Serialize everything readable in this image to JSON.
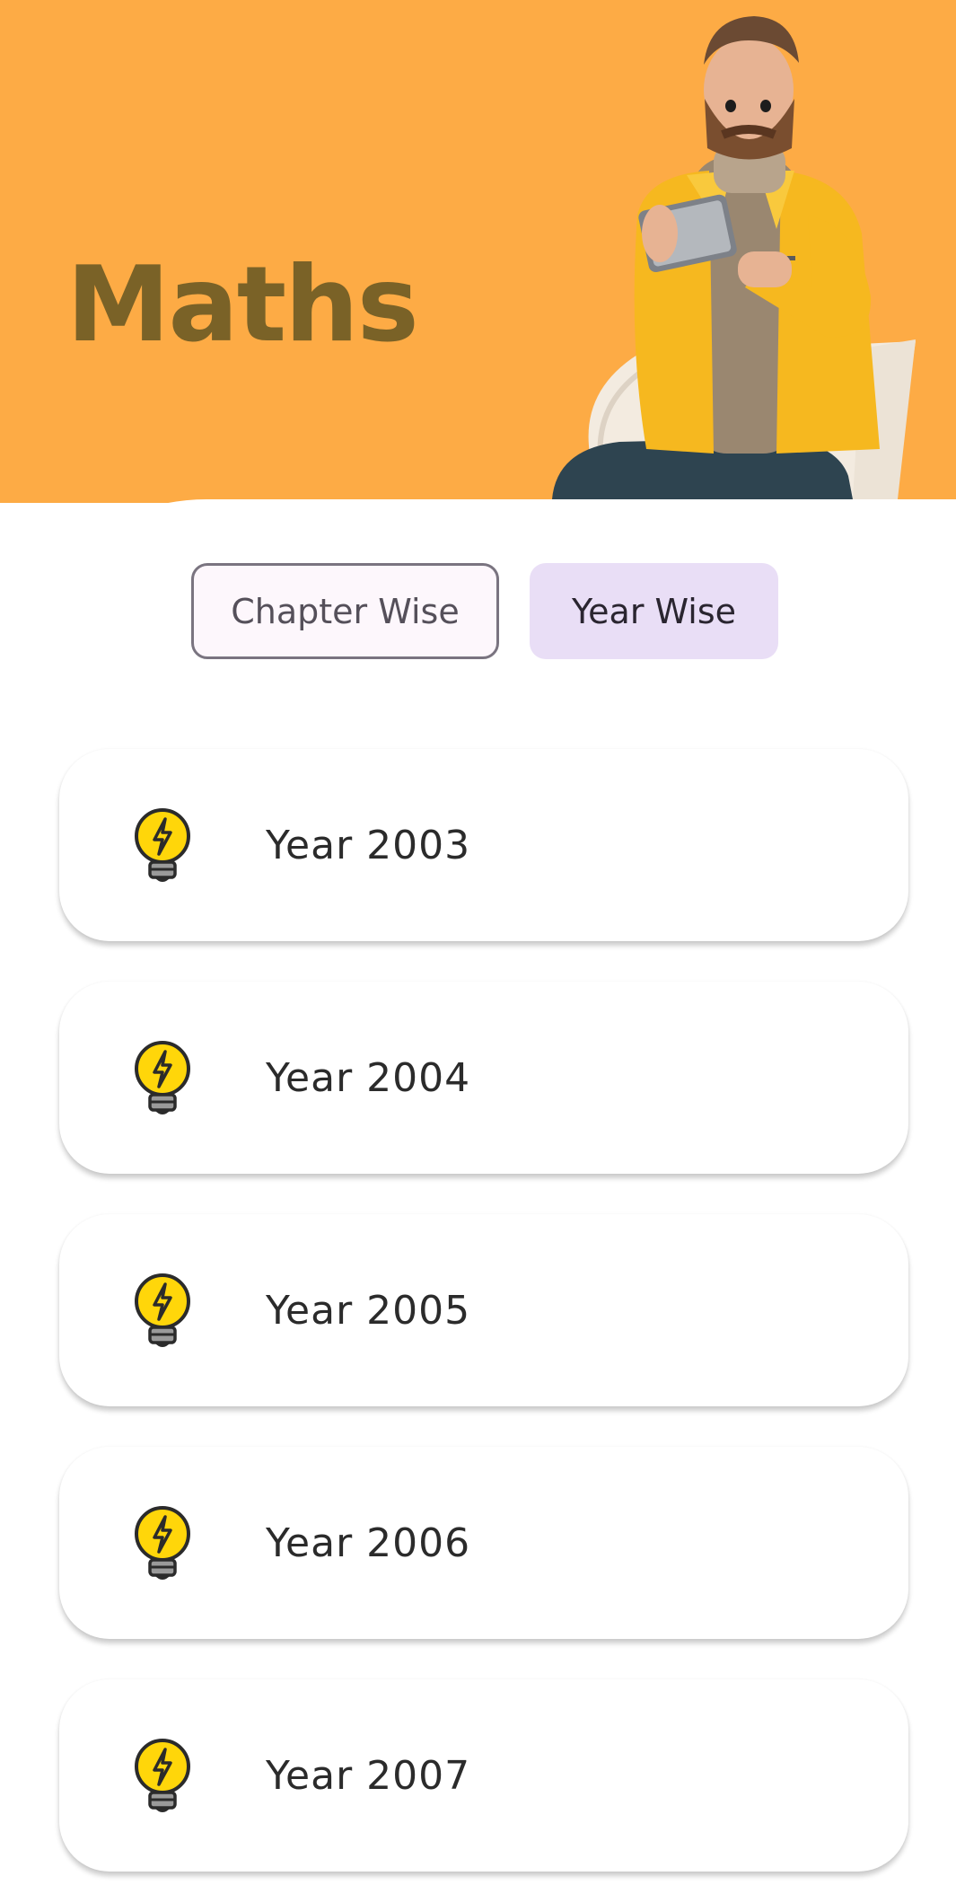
{
  "header": {
    "title": "Maths",
    "background_color": "#fdab45",
    "title_color": "#7a6227",
    "illustration": "person-with-tablet-3d-avatar"
  },
  "tabs": [
    {
      "label": "Chapter Wise",
      "selected": false
    },
    {
      "label": "Year Wise",
      "selected": true
    }
  ],
  "years": [
    {
      "label": "Year 2003",
      "icon": "lightbulb-icon"
    },
    {
      "label": "Year 2004",
      "icon": "lightbulb-icon"
    },
    {
      "label": "Year 2005",
      "icon": "lightbulb-icon"
    },
    {
      "label": "Year 2006",
      "icon": "lightbulb-icon"
    },
    {
      "label": "Year 2007",
      "icon": "lightbulb-icon"
    }
  ],
  "colors": {
    "accent_selected_tab": "#e9def6",
    "bulb_yellow": "#ffd60a"
  }
}
